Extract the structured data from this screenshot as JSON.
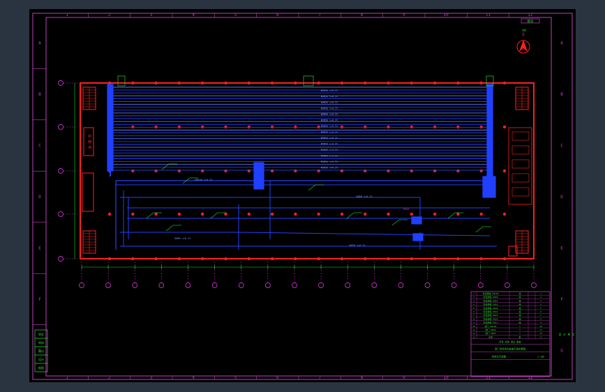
{
  "viewport": {
    "background": "#2a3440",
    "sheet": "#000000"
  },
  "colors": {
    "frame": "#c040c0",
    "wall": "#ff2020",
    "pipe": "#2040ff",
    "pipe_light": "#5a74ff",
    "annot": "#20e020",
    "text_pipe": "#8090ff",
    "grid": "#ff40ff"
  },
  "top_cols": [
    "1",
    "2",
    "3",
    "4",
    "5",
    "6",
    "7",
    "8",
    "9",
    "10",
    "11",
    "12"
  ],
  "bottom_cols": [
    "1",
    "2",
    "3",
    "4",
    "5",
    "6",
    "7",
    "8",
    "9",
    "10",
    "11",
    "12"
  ],
  "left_rows": [
    "A",
    "B",
    "C",
    "D",
    "E",
    "F",
    "G"
  ],
  "right_rows": [
    "A",
    "B",
    "C",
    "D",
    "E",
    "F",
    "G"
  ],
  "axis_rows": [
    "1",
    "2",
    "3",
    "4",
    "5"
  ],
  "axis_cols": [
    "1",
    "2",
    "3",
    "4",
    "5",
    "6",
    "7",
    "8",
    "9",
    "10",
    "11",
    "12",
    "13",
    "14",
    "15",
    "16",
    "17",
    "18"
  ],
  "north": {
    "label": "北",
    "tag": "图号"
  },
  "equipment_label": "设 备 间",
  "title_block": {
    "rows": [
      [
        "1",
        "管道规格 DN100",
        "组",
        "1"
      ],
      [
        "2",
        "管道规格 DN80",
        "组",
        "2"
      ],
      [
        "3",
        "管道规格 DN65",
        "组",
        "3"
      ],
      [
        "4",
        "管道规格 DN50",
        "组",
        "4"
      ],
      [
        "5",
        "管道规格 DN40",
        "组",
        "5"
      ],
      [
        "6",
        "管道规格 DN32",
        "组",
        "6"
      ],
      [
        "7",
        "管道规格 DN25",
        "组",
        "7"
      ],
      [
        "8",
        "管道规格 DN20",
        "组",
        "8"
      ],
      [
        "9",
        "管道规格 DN15",
        "组",
        "9"
      ],
      [
        "10",
        "阀门 DN100",
        "个",
        "10"
      ],
      [
        "11",
        "阀门 DN50",
        "个",
        "11"
      ],
      [
        "12",
        "阀门 DN25",
        "个",
        "12"
      ],
      [
        "13",
        "支架",
        "套",
        "13"
      ]
    ],
    "header": "序号  名称  单位  数量",
    "project": "某厂房给排水管道平面布置图",
    "drawing": "给排水平面图",
    "scale": "1:100"
  },
  "revision_block": [
    "审定",
    "审核",
    "校对",
    "设计",
    "制图"
  ]
}
